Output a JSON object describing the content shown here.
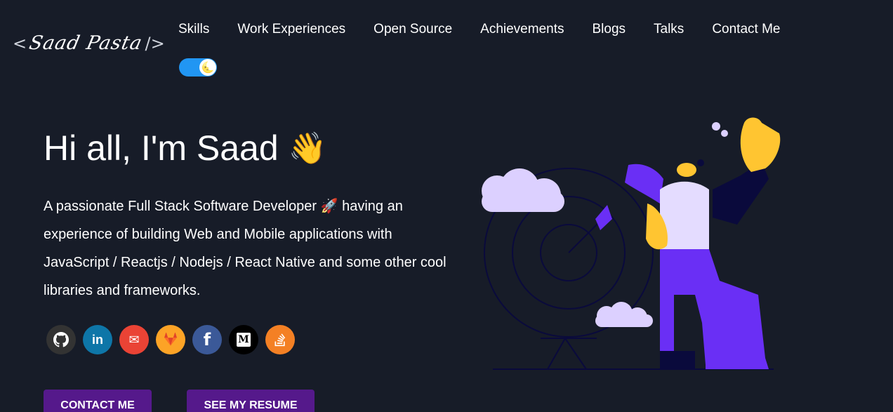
{
  "header": {
    "logo": {
      "open": "<",
      "name": "Saad Pasta",
      "close": "/>"
    },
    "nav": [
      "Skills",
      "Work Experiences",
      "Open Source",
      "Achievements",
      "Blogs",
      "Talks",
      "Contact Me"
    ],
    "theme_toggle_icon": "🌜"
  },
  "hero": {
    "greeting": "Hi all, I'm Saad",
    "wave_emoji": "👋",
    "bio": "A passionate Full Stack Software Developer 🚀 having an experience of building Web and Mobile applications with JavaScript / Reactjs / Nodejs / React Native and some other cool libraries and frameworks.",
    "socials": [
      {
        "icon": "github-icon",
        "glyph": "",
        "color": "#333333"
      },
      {
        "icon": "linkedin-icon",
        "glyph": "in",
        "color": "#0e76a8"
      },
      {
        "icon": "email-icon",
        "glyph": "✉",
        "color": "#ea4335"
      },
      {
        "icon": "gitlab-icon",
        "glyph": "",
        "color": "#fca326"
      },
      {
        "icon": "facebook-icon",
        "glyph": "f",
        "color": "#3b5998"
      },
      {
        "icon": "medium-icon",
        "glyph": "M",
        "color": "#000000"
      },
      {
        "icon": "stack-overflow-icon",
        "glyph": "",
        "color": "#f48024"
      }
    ],
    "buttons": {
      "contact": "CONTACT ME",
      "resume": "SEE MY RESUME"
    }
  },
  "colors": {
    "background": "#171c28",
    "button": "#55198b",
    "toggle": "#2196f3",
    "accent_purple": "#6a2ff5"
  }
}
